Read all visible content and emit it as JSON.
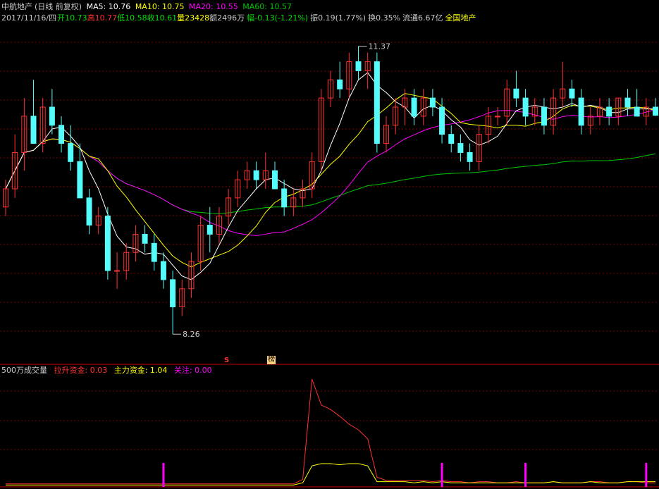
{
  "header": {
    "stock_name": "中航地产",
    "period_label": "(日线 前复权)",
    "ma5": "MA5: 10.76",
    "ma10": "MA10: 10.75",
    "ma20": "MA20: 10.55",
    "ma60": "MA60: 10.57",
    "date": "2017/11/16/四",
    "open": "开10.73",
    "high": "高10.77",
    "low": "低10.58",
    "close": "收10.61",
    "volume": "量23428",
    "amount": "额2496万",
    "change": "幅-0.13(-1.21%)",
    "amplitude": "振0.19(1.77%)",
    "turnover": "换0.35%",
    "float_cap": "流通6.67亿",
    "sector": "全国地产"
  },
  "markers": {
    "high_label": "11.37",
    "low_label": "8.26",
    "signal_s": "S",
    "signal_list": "榜"
  },
  "indicator": {
    "name": "500万成交量",
    "lasheng": "拉升资金: 0.03",
    "zhuli": "主力资金: 1.04",
    "guanzhu": "关注: 0.00"
  },
  "colors": {
    "up": "#ff3232",
    "down": "#54fcfc",
    "ma5": "#ffffff",
    "ma10": "#ffff00",
    "ma20": "#ff00ff",
    "ma60": "#00c800",
    "grid": "#7d0000",
    "lasheng": "#ff3232",
    "zhuli": "#ffff00",
    "guanzhu": "#ff00ff"
  },
  "chart_data": {
    "type": "candlestick",
    "price_range": [
      8.0,
      11.6
    ],
    "candles": [
      [
        9.6,
        9.9,
        9.5,
        9.8
      ],
      [
        9.8,
        10.4,
        9.7,
        10.2
      ],
      [
        10.2,
        10.8,
        10.0,
        10.6
      ],
      [
        10.6,
        11.0,
        10.4,
        10.3
      ],
      [
        10.3,
        10.8,
        10.2,
        10.7
      ],
      [
        10.7,
        10.9,
        10.4,
        10.5
      ],
      [
        10.5,
        10.6,
        10.2,
        10.3
      ],
      [
        10.3,
        10.5,
        10.0,
        10.1
      ],
      [
        10.1,
        10.3,
        9.8,
        9.7
      ],
      [
        9.7,
        9.8,
        9.3,
        9.4
      ],
      [
        9.4,
        9.6,
        9.3,
        9.5
      ],
      [
        9.5,
        9.6,
        8.8,
        8.9
      ],
      [
        8.9,
        9.1,
        8.7,
        8.9
      ],
      [
        8.9,
        9.2,
        8.8,
        9.1
      ],
      [
        9.1,
        9.4,
        9.0,
        9.3
      ],
      [
        9.3,
        9.4,
        9.1,
        9.2
      ],
      [
        9.2,
        9.3,
        8.9,
        9.0
      ],
      [
        9.0,
        9.1,
        8.7,
        8.8
      ],
      [
        8.8,
        8.9,
        8.2,
        8.5
      ],
      [
        8.5,
        8.8,
        8.4,
        8.7
      ],
      [
        8.7,
        9.1,
        8.6,
        9.0
      ],
      [
        9.0,
        9.5,
        8.9,
        9.4
      ],
      [
        9.4,
        9.6,
        9.1,
        9.3
      ],
      [
        9.3,
        9.6,
        9.2,
        9.5
      ],
      [
        9.5,
        9.8,
        9.4,
        9.7
      ],
      [
        9.7,
        10.0,
        9.6,
        9.9
      ],
      [
        9.9,
        10.1,
        9.8,
        10.0
      ],
      [
        10.0,
        10.1,
        9.8,
        9.9
      ],
      [
        9.9,
        10.2,
        9.8,
        10.0
      ],
      [
        10.0,
        10.1,
        9.8,
        9.8
      ],
      [
        9.8,
        9.9,
        9.5,
        9.6
      ],
      [
        9.6,
        9.8,
        9.5,
        9.7
      ],
      [
        9.7,
        9.9,
        9.6,
        9.8
      ],
      [
        9.8,
        10.2,
        9.7,
        10.1
      ],
      [
        10.1,
        10.9,
        10.0,
        10.8
      ],
      [
        10.8,
        11.1,
        10.7,
        11.0
      ],
      [
        11.0,
        11.2,
        10.8,
        10.9
      ],
      [
        10.9,
        11.3,
        10.8,
        11.2
      ],
      [
        11.2,
        11.37,
        11.0,
        11.1
      ],
      [
        11.1,
        11.3,
        10.9,
        11.2
      ],
      [
        11.2,
        11.3,
        10.2,
        10.3
      ],
      [
        10.3,
        10.6,
        10.2,
        10.5
      ],
      [
        10.5,
        10.8,
        10.4,
        10.7
      ],
      [
        10.7,
        10.9,
        10.5,
        10.8
      ],
      [
        10.8,
        10.9,
        10.5,
        10.6
      ],
      [
        10.6,
        10.9,
        10.5,
        10.8
      ],
      [
        10.8,
        10.9,
        10.6,
        10.7
      ],
      [
        10.7,
        10.8,
        10.3,
        10.4
      ],
      [
        10.4,
        10.5,
        10.2,
        10.3
      ],
      [
        10.3,
        10.4,
        10.1,
        10.2
      ],
      [
        10.2,
        10.3,
        10.0,
        10.1
      ],
      [
        10.1,
        10.5,
        10.0,
        10.4
      ],
      [
        10.4,
        10.7,
        10.3,
        10.6
      ],
      [
        10.6,
        10.7,
        10.5,
        10.6
      ],
      [
        10.6,
        11.0,
        10.5,
        10.9
      ],
      [
        10.9,
        11.1,
        10.7,
        10.8
      ],
      [
        10.8,
        10.9,
        10.5,
        10.6
      ],
      [
        10.6,
        10.8,
        10.5,
        10.7
      ],
      [
        10.7,
        10.8,
        10.4,
        10.5
      ],
      [
        10.5,
        10.9,
        10.4,
        10.8
      ],
      [
        10.8,
        11.2,
        10.7,
        10.9
      ],
      [
        10.9,
        11.0,
        10.7,
        10.8
      ],
      [
        10.8,
        10.9,
        10.4,
        10.5
      ],
      [
        10.5,
        10.7,
        10.4,
        10.6
      ],
      [
        10.6,
        10.8,
        10.5,
        10.7
      ],
      [
        10.7,
        10.8,
        10.5,
        10.6
      ],
      [
        10.6,
        10.8,
        10.5,
        10.8
      ],
      [
        10.8,
        10.9,
        10.6,
        10.7
      ],
      [
        10.7,
        10.9,
        10.6,
        10.6
      ],
      [
        10.6,
        10.8,
        10.5,
        10.7
      ],
      [
        10.7,
        10.8,
        10.6,
        10.61
      ]
    ],
    "indicator_lasheng": [
      0.02,
      0.02,
      0.02,
      0.02,
      0.02,
      0.02,
      0.02,
      0.02,
      0.02,
      0.02,
      0.02,
      0.02,
      0.02,
      0.02,
      0.02,
      0.02,
      0.02,
      0.02,
      0.02,
      0.02,
      0.02,
      0.02,
      0.02,
      0.02,
      0.02,
      0.02,
      0.02,
      0.02,
      0.02,
      0.02,
      0.02,
      0.02,
      0.06,
      0.95,
      0.72,
      0.68,
      0.62,
      0.55,
      0.5,
      0.42,
      0.08,
      0.05,
      0.05,
      0.05,
      0.05,
      0.05,
      0.04,
      0.05,
      0.04,
      0.04,
      0.03,
      0.04,
      0.04,
      0.03,
      0.03,
      0.04,
      0.03,
      0.03,
      0.03,
      0.04,
      0.03,
      0.03,
      0.03,
      0.04,
      0.04,
      0.03,
      0.03,
      0.04,
      0.04,
      0.03,
      0.03
    ],
    "indicator_zhuli": [
      0.01,
      0.01,
      0.01,
      0.01,
      0.01,
      0.01,
      0.01,
      0.01,
      0.01,
      0.01,
      0.01,
      0.01,
      0.01,
      0.01,
      0.01,
      0.01,
      0.01,
      0.01,
      0.01,
      0.01,
      0.01,
      0.01,
      0.01,
      0.01,
      0.01,
      0.01,
      0.01,
      0.01,
      0.01,
      0.01,
      0.01,
      0.01,
      0.03,
      0.18,
      0.2,
      0.2,
      0.19,
      0.2,
      0.2,
      0.18,
      0.04,
      0.04,
      0.04,
      0.04,
      0.03,
      0.04,
      0.03,
      0.04,
      0.03,
      0.03,
      0.03,
      0.03,
      0.03,
      0.03,
      0.03,
      0.03,
      0.03,
      0.03,
      0.03,
      0.04,
      0.03,
      0.03,
      0.03,
      0.04,
      0.03,
      0.03,
      0.03,
      0.04,
      0.04,
      0.04,
      0.04
    ],
    "guanzhu_bars": [
      17,
      47,
      56,
      69
    ]
  }
}
